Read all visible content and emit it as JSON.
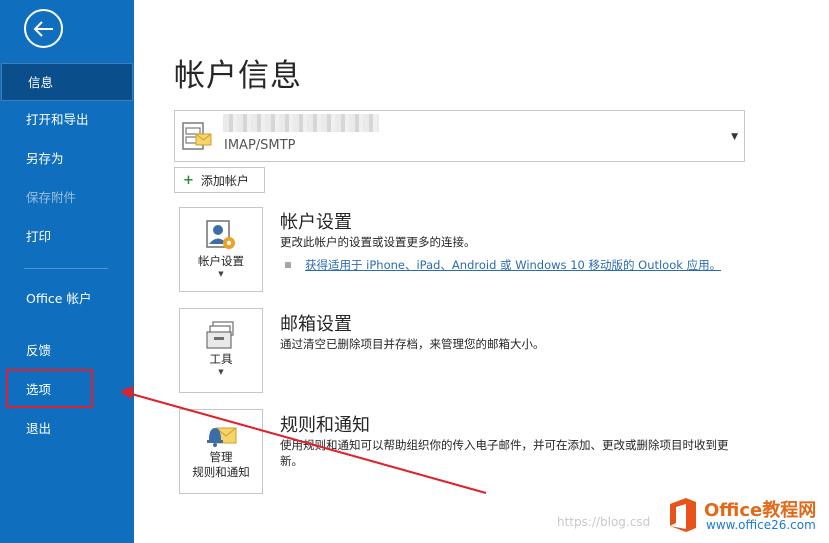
{
  "sidebar": {
    "items": [
      {
        "label": "信息"
      },
      {
        "label": "打开和导出"
      },
      {
        "label": "另存为"
      },
      {
        "label": "保存附件"
      },
      {
        "label": "打印"
      },
      {
        "label": "Office 帐户"
      },
      {
        "label": "反馈"
      },
      {
        "label": "选项"
      },
      {
        "label": "退出"
      }
    ],
    "active_color": "#0a4f8c",
    "background_color": "#106ebe"
  },
  "main": {
    "title": "帐户信息",
    "account": {
      "type": "IMAP/SMTP"
    },
    "add_account_label": "添加帐户",
    "sections": [
      {
        "button_label": "帐户设置",
        "title": "帐户设置",
        "description": "更改此帐户的设置或设置更多的连接。",
        "link": "获得适用于 iPhone、iPad、Android 或 Windows 10 移动版的 Outlook 应用。"
      },
      {
        "button_label": "工具",
        "title": "邮箱设置",
        "description": "通过清空已删除项目并存档，来管理您的邮箱大小。"
      },
      {
        "button_label_line1": "管理",
        "button_label_line2": "规则和通知",
        "title": "规则和通知",
        "description": "使用规则和通知可以帮助组织你的传入电子邮件，并可在添加、更改或删除项目时收到更新。"
      }
    ]
  },
  "watermark": {
    "blog_url": "https://blog.csd",
    "brand": "Office教程网",
    "site": "www.office26.com"
  },
  "annotation_color": "#e0202a"
}
